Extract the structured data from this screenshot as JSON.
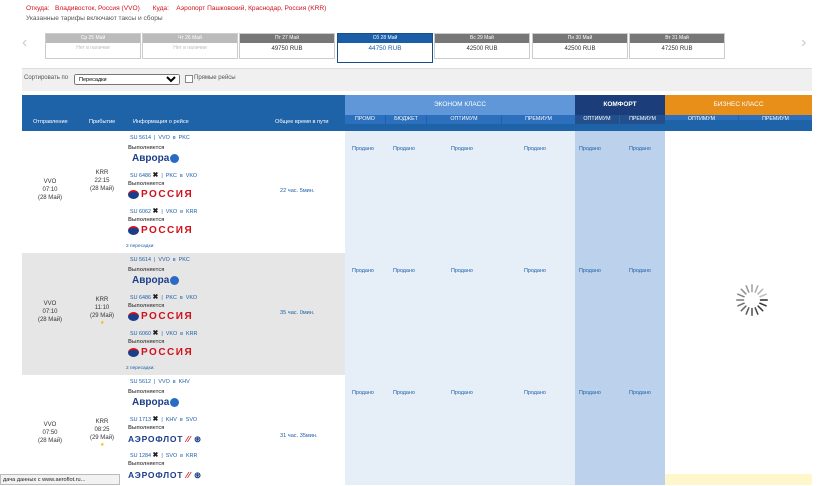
{
  "header": {
    "from_label": "Откуда:",
    "from_value": "Владивосток, Россия (VVO)",
    "to_label": "Куда:",
    "to_value": "Аэропорт Пашковский, Краснодар, Россия (KRR)",
    "note": "Указанные тарифы включают таксы и сборы"
  },
  "dates": [
    {
      "label": "Ср 25 Май",
      "value": "Нет в наличии",
      "state": "disabled"
    },
    {
      "label": "Чт 26 Май",
      "value": "Нет в наличии",
      "state": "disabled"
    },
    {
      "label": "Пт 27 Май",
      "value": "49750 RUB",
      "state": "normal"
    },
    {
      "label": "Сб 28 Май",
      "value": "44750 RUB",
      "state": "selected"
    },
    {
      "label": "Вс 29 Май",
      "value": "42500 RUB",
      "state": "normal"
    },
    {
      "label": "Пн 30 Май",
      "value": "42500 RUB",
      "state": "normal"
    },
    {
      "label": "Вт 31 Май",
      "value": "47250 RUB",
      "state": "normal"
    }
  ],
  "nav": {
    "prev": "‹",
    "next": "›"
  },
  "sort": {
    "label": "Сортировать по",
    "selected": "Пересадки",
    "direct_label": "Прямые рейсы"
  },
  "table": {
    "groups": {
      "economy": "ЭКОНОМ КЛАСС",
      "comfort": "КОМФОРТ",
      "business": "БИЗНЕС КЛАСС"
    },
    "columns": {
      "departure": "Отправление",
      "arrival": "Прибытие",
      "info": "Информация о рейсе",
      "total_time": "Общее время в пути"
    },
    "economy_sub": [
      "ПРОМО",
      "БЮДЖЕТ",
      "ОПТИМУМ",
      "ПРЕМИУМ"
    ],
    "comfort_sub": [
      "ОПТИМУМ",
      "ПРЕМИУМ"
    ],
    "business_sub": [
      "ОПТИМУМ",
      "ПРЕМИУМ"
    ]
  },
  "rows": [
    {
      "dep_code": "VVO",
      "dep_time": "07:10",
      "dep_date": "(28 Май)",
      "arr_code": "KRR",
      "arr_time": "22:15",
      "arr_date": "(28 Май)",
      "duration": "22 час. 5мин.",
      "transfers": "2 пересадки:",
      "segments": [
        {
          "flight": "SU 5614",
          "from": "VVO",
          "word": "в",
          "to": "PKC",
          "operated": "Выполняется",
          "carrier": "Аврора"
        },
        {
          "flight": "SU 6486",
          "from": "PKC",
          "word": "в",
          "to": "VKO",
          "operated": "Выполняется",
          "carrier": "РОССИЯ"
        },
        {
          "flight": "SU 6062",
          "from": "VKO",
          "word": "в",
          "to": "KRR",
          "operated": "Выполняется",
          "carrier": "РОССИЯ"
        }
      ],
      "fares": [
        "Продано",
        "Продано",
        "Продано",
        "Продано",
        "Продано",
        "Продано"
      ]
    },
    {
      "dep_code": "VVO",
      "dep_time": "07:10",
      "dep_date": "(28 Май)",
      "arr_code": "KRR",
      "arr_time": "11:10",
      "arr_date": "(29 Май)",
      "duration": "35 час. 0мин.",
      "transfers": "2 пересадки:",
      "segments": [
        {
          "flight": "SU 5614",
          "from": "VVO",
          "word": "в",
          "to": "PKC",
          "operated": "Выполняется",
          "carrier": "Аврора"
        },
        {
          "flight": "SU 6486",
          "from": "PKC",
          "word": "в",
          "to": "VKO",
          "operated": "Выполняется",
          "carrier": "РОССИЯ"
        },
        {
          "flight": "SU 6060",
          "from": "VKO",
          "word": "в",
          "to": "KRR",
          "operated": "Выполняется",
          "carrier": "РОССИЯ"
        }
      ],
      "fares": [
        "Продано",
        "Продано",
        "Продано",
        "Продано",
        "Продано",
        "Продано"
      ]
    },
    {
      "dep_code": "VVO",
      "dep_time": "07:50",
      "dep_date": "(28 Май)",
      "arr_code": "KRR",
      "arr_time": "08:25",
      "arr_date": "(29 Май)",
      "duration": "31 час. 35мин.",
      "transfers": "",
      "segments": [
        {
          "flight": "SU 5612",
          "from": "VVO",
          "word": "в",
          "to": "KHV",
          "operated": "Выполняется",
          "carrier": "Аврора"
        },
        {
          "flight": "SU 1713",
          "from": "KHV",
          "word": "в",
          "to": "SVO",
          "operated": "Выполняется",
          "carrier": "АЭРОФЛОТ"
        },
        {
          "flight": "SU 1284",
          "from": "SVO",
          "word": "в",
          "to": "KRR",
          "operated": "Выполняется",
          "carrier": "АЭРОФЛОТ"
        }
      ],
      "fares": [
        "Продано",
        "Продано",
        "Продано",
        "Продано",
        "Продано",
        "Продано"
      ]
    }
  ],
  "status_bar": "дача данных с www.aeroflot.ru...",
  "colors": {
    "header_blue": "#1e62a8",
    "economy_blue": "#5f97d8",
    "comfort_navy": "#1b3e7a",
    "business_orange": "#e88f1a",
    "red": "#d0101b"
  }
}
